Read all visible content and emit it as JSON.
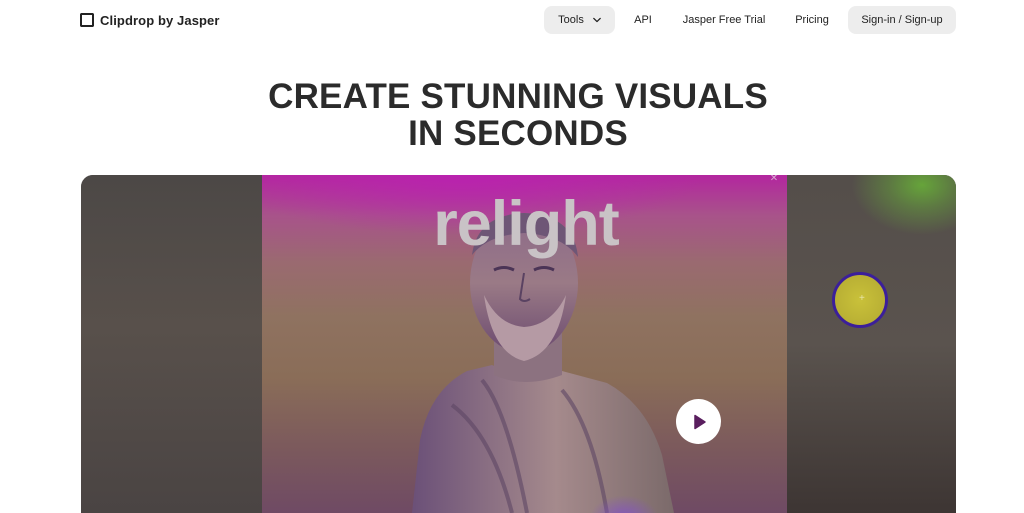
{
  "brand": {
    "name": "Clipdrop by Jasper"
  },
  "nav": {
    "tools_label": "Tools",
    "api_label": "API",
    "trial_label": "Jasper Free Trial",
    "pricing_label": "Pricing",
    "signin_label": "Sign-in / Sign-up"
  },
  "hero": {
    "title_line1": "CREATE STUNNING VISUALS",
    "title_line2": "IN SECONDS"
  },
  "video": {
    "overlay_text": "relight",
    "close_glyph": "✕",
    "light_marker": "+",
    "icons": {
      "play": "play-icon",
      "chevron": "chevron-down-icon",
      "logo": "clipdrop-logo-icon"
    }
  },
  "colors": {
    "accent_bg": "#ededed",
    "magenta": "#b3269f",
    "light_ring": "#3b1f9a",
    "light_fill": "#c9c13a"
  }
}
